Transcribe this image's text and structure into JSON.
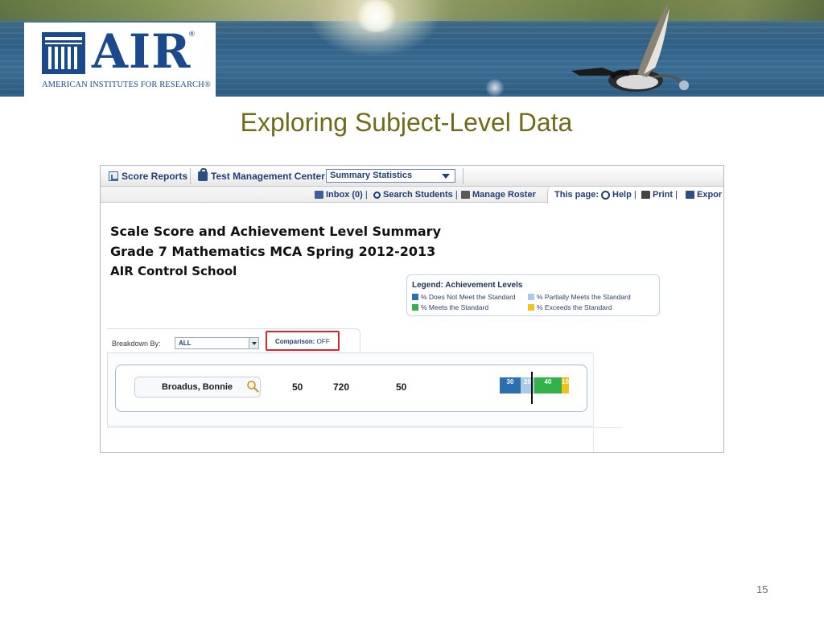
{
  "logo": {
    "letters": "AIR",
    "registered": "®",
    "tagline": "AMERICAN INSTITUTES FOR RESEARCH®"
  },
  "slide": {
    "title": "Exploring Subject-Level Data",
    "page_number": "15"
  },
  "app": {
    "nav_primary": {
      "score_reports": "Score Reports",
      "test_management_center": "Test Management Center",
      "summary_select_value": "Summary Statistics"
    },
    "nav_secondary": {
      "inbox": "Inbox (0)",
      "search_students": "Search Students",
      "manage_roster": "Manage Roster",
      "this_page": "This page:",
      "help": "Help",
      "print": "Print",
      "export": "Expor"
    },
    "report": {
      "heading": "Scale Score and Achievement Level Summary",
      "test": "Grade 7 Mathematics MCA Spring 2012-2013",
      "school": "AIR Control School"
    },
    "legend": {
      "title": "Legend: Achievement Levels",
      "items": [
        {
          "label": "% Does Not Meet the Standard",
          "color": "#2a6fb2"
        },
        {
          "label": "% Partially Meets the Standard",
          "color": "#a9cbe8"
        },
        {
          "label": "% Meets the Standard",
          "color": "#34b24a"
        },
        {
          "label": "% Exceeds the Standard",
          "color": "#f2c21b"
        }
      ]
    },
    "filters": {
      "breakdown_label": "Breakdown By:",
      "breakdown_value": "ALL",
      "comparison_label": "Comparison:",
      "comparison_value": "OFF"
    },
    "student_row": {
      "name": "Broadus, Bonnie",
      "value_1": "50",
      "scale_score": "720",
      "value_3": "50",
      "distribution": [
        {
          "level": "does-not-meet",
          "label": "30",
          "percent": 30,
          "color": "#2a6fb2"
        },
        {
          "level": "partially-meets",
          "label": "20",
          "percent": 20,
          "color": "#a9cbe8"
        },
        {
          "level": "meets",
          "label": "40",
          "percent": 40,
          "color": "#34b24a"
        },
        {
          "level": "exceeds",
          "label": "10",
          "percent": 10,
          "color": "#f2c21b"
        }
      ]
    }
  }
}
